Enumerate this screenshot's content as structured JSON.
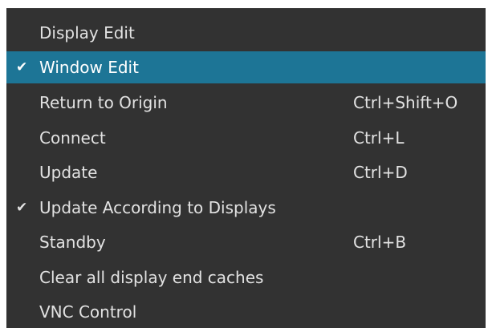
{
  "menu": {
    "items": [
      {
        "label": "Display Edit",
        "shortcut": "",
        "checked": false,
        "highlighted": false,
        "check_glyph": ""
      },
      {
        "label": "Window Edit",
        "shortcut": "",
        "checked": true,
        "highlighted": true,
        "check_glyph": "✔"
      },
      {
        "label": "Return to Origin",
        "shortcut": "Ctrl+Shift+O",
        "checked": false,
        "highlighted": false,
        "check_glyph": ""
      },
      {
        "label": "Connect",
        "shortcut": "Ctrl+L",
        "checked": false,
        "highlighted": false,
        "check_glyph": ""
      },
      {
        "label": "Update",
        "shortcut": "Ctrl+D",
        "checked": false,
        "highlighted": false,
        "check_glyph": ""
      },
      {
        "label": "Update According to Displays",
        "shortcut": "",
        "checked": true,
        "highlighted": false,
        "check_glyph": "✔"
      },
      {
        "label": "Standby",
        "shortcut": "Ctrl+B",
        "checked": false,
        "highlighted": false,
        "check_glyph": ""
      },
      {
        "label": "Clear all display end caches",
        "shortcut": "",
        "checked": false,
        "highlighted": false,
        "check_glyph": ""
      },
      {
        "label": "VNC Control",
        "shortcut": "",
        "checked": false,
        "highlighted": false,
        "check_glyph": ""
      }
    ]
  },
  "colors": {
    "menu_background": "#323232",
    "highlight": "#1d7596",
    "text": "#e2e2e2"
  }
}
